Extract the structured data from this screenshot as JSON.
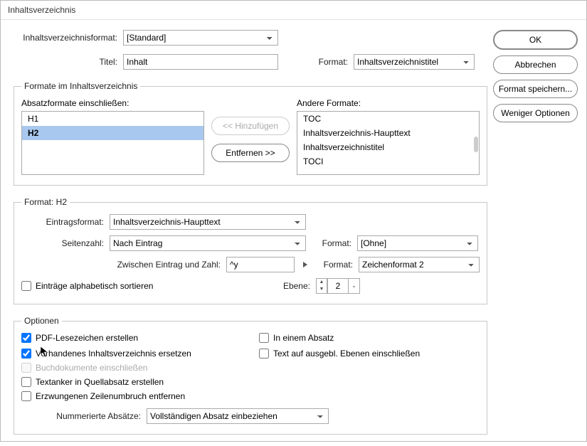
{
  "title": "Inhaltsverzeichnis",
  "labels": {
    "tocFormat": "Inhaltsverzeichnisformat:",
    "titel": "Titel:",
    "format": "Format:",
    "formateGroup": "Formate im Inhaltsverzeichnis",
    "absatzInclude": "Absatzformate einschließen:",
    "andereFormate": "Andere Formate:",
    "hinzufuegen": "<< Hinzufügen",
    "entfernen": "Entfernen >>",
    "formatH2": "Format: H2",
    "eintragsformat": "Eintragsformat:",
    "seitenzahl": "Seitenzahl:",
    "zwischen": "Zwischen Eintrag und Zahl:",
    "format2": "Format:",
    "format3": "Format:",
    "ebene": "Ebene:",
    "alphabetisch": "Einträge alphabetisch sortieren",
    "optionen": "Optionen",
    "pdf": "PDF-Lesezeichen erstellen",
    "vorhandenes": "Vorhandenes Inhaltsverzeichnis ersetzen",
    "buchdok": "Buchdokumente einschließen",
    "textanker": "Textanker in Quellabsatz erstellen",
    "erzwungen": "Erzwungenen Zeilenumbruch entfernen",
    "inEinemAbsatz": "In einem Absatz",
    "textAufAusgebl": "Text auf ausgebl. Ebenen einschließen",
    "nummerierteAbs": "Nummerierte Absätze:"
  },
  "values": {
    "tocFormatSel": "[Standard]",
    "titelInput": "Inhalt",
    "formatTitleSel": "Inhaltsverzeichnistitel",
    "eintragsformatSel": "Inhaltsverzeichnis-Haupttext",
    "seitenzahlSel": "Nach Eintrag",
    "zwischenInput": "^y",
    "format2Sel": "[Ohne]",
    "format3Sel": "Zeichenformat 2",
    "ebeneVal": "2",
    "nummerierteSel": "Vollständigen Absatz einbeziehen"
  },
  "includeList": [
    "H1",
    "H2"
  ],
  "otherList": [
    "TOC",
    "Inhaltsverzeichnis-Haupttext",
    "Inhaltsverzeichnistitel",
    "TOCI"
  ],
  "buttons": {
    "ok": "OK",
    "abbrechen": "Abbrechen",
    "speichern": "Format speichern...",
    "weniger": "Weniger Optionen"
  },
  "checked": {
    "pdf": true,
    "vorhandenes": true,
    "buchdok": false,
    "textanker": false,
    "erzwungen": false,
    "inEinemAbsatz": false,
    "textAufAusgebl": false,
    "alphabetisch": false
  }
}
